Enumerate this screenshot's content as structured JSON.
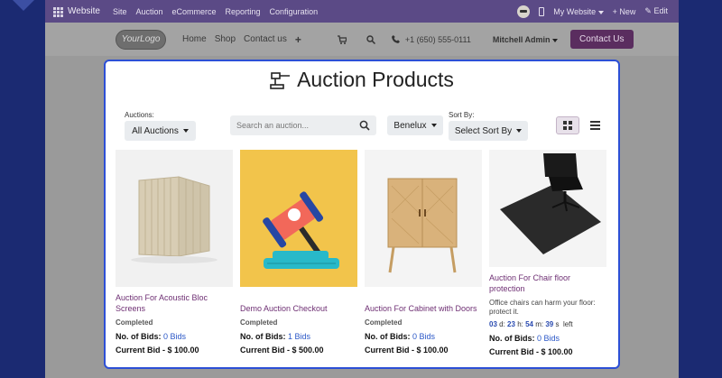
{
  "admin_bar": {
    "brand": "Website",
    "menu": [
      "Site",
      "Auction",
      "eCommerce",
      "Reporting",
      "Configuration"
    ],
    "my_website": "My Website",
    "new_label": "+ New",
    "edit_label": "Edit"
  },
  "site_header": {
    "logo": "YourLogo",
    "nav": [
      "Home",
      "Shop",
      "Contact us"
    ],
    "phone": "+1 (650) 555-0111",
    "user": "Mitchell Admin",
    "contact_button": "Contact Us"
  },
  "page": {
    "title": "Auction Products",
    "auctions_label": "Auctions:",
    "auctions_value": "All Auctions",
    "search_placeholder": "Search an auction...",
    "pricelist": "Benelux",
    "sort_label": "Sort By:",
    "sort_value": "Select Sort By"
  },
  "products": [
    {
      "name": "Auction For Acoustic Bloc Screens",
      "status": "Completed",
      "bids_label": "No. of Bids:",
      "bids_value": "0 Bids",
      "current_bid": "Current Bid - $ 100.00"
    },
    {
      "name": "Demo Auction Checkout",
      "status": "Completed",
      "bids_label": "No. of Bids:",
      "bids_value": "1 Bids",
      "current_bid": "Current Bid - $ 500.00"
    },
    {
      "name": "Auction For Cabinet with Doors",
      "status": "Completed",
      "bids_label": "No. of Bids:",
      "bids_value": "0 Bids",
      "current_bid": "Current Bid - $ 100.00"
    },
    {
      "name": "Auction For Chair floor protection",
      "description": "Office chairs can harm your floor: protect it.",
      "timer": {
        "days": "03",
        "d": "d:",
        "hours": "23",
        "h": "h:",
        "minutes": "54",
        "m": "m:",
        "seconds": "39",
        "s": "s",
        "left": "left"
      },
      "bids_label": "No. of Bids:",
      "bids_value": "0 Bids",
      "current_bid": "Current Bid - $ 100.00"
    }
  ],
  "colors": {
    "admin_bar": "#5b4a86",
    "accent_purple": "#6e2f73",
    "contact_btn": "#5a2d5f",
    "card_border": "#2c4fd6",
    "link_blue": "#2a57c7"
  }
}
